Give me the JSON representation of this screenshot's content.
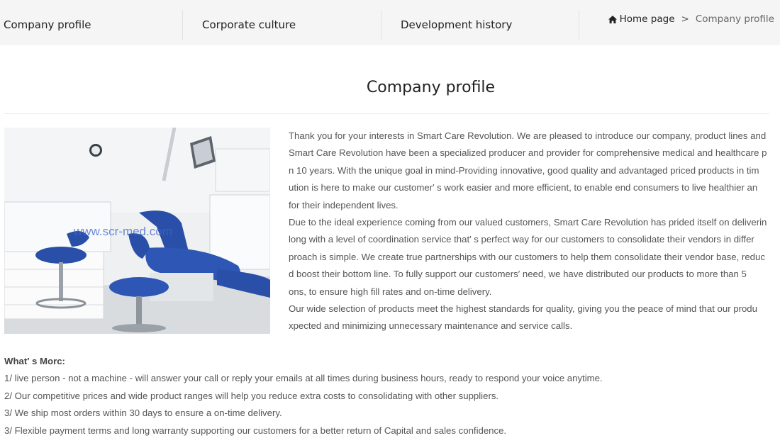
{
  "nav": {
    "tabs": [
      {
        "label": "Company profile"
      },
      {
        "label": "Corporate culture"
      },
      {
        "label": "Development history"
      }
    ],
    "breadcrumb": {
      "home_icon": "home-icon",
      "home": "Home page",
      "separator": ">",
      "current": "Company profile"
    }
  },
  "main": {
    "title": "Company profile",
    "photo": {
      "watermark": "www.scr-med.com",
      "accent_color": "#2a4fa8"
    },
    "intro_lines": [
      "Thank you for your interests in Smart Care Revolution. We are pleased to introduce our company, product lines and",
      "Smart Care Revolution have been a specialized producer and provider for comprehensive medical and healthcare p",
      "n 10 years. With the unique goal in mind-Providing innovative, good quality and advantaged priced products in tim",
      "ution is here to make our customer′ s work easier and more efficient, to enable end consumers to live healthier an",
      "for their independent lives.",
      "Due to the ideal experience coming from our valued customers, Smart Care Revolution has prided itself on deliverin",
      "long with a level of coordination service that′ s perfect way for our customers to consolidate their vendors in differ",
      "proach is simple. We create true partnerships with our customers to help them consolidate their vendor base, reduc",
      "d boost their bottom line. To fully support our customers′   need, we have distributed our products to more than 5",
      "ons, to ensure high fill rates and on-time delivery.",
      "Our wide selection of products meet the highest standards for quality, giving you the peace of mind that our produ",
      "xpected and minimizing unnecessary maintenance and service calls."
    ],
    "more": {
      "title": "What′ s Morc:",
      "items": [
        "1/ live person - not a machine - will answer your call or reply your emails at all times during business hours, ready to respond your voice anytime.",
        "2/ Our competitive prices and wide product ranges will help you reduce extra costs to consolidating with other suppliers.",
        "3/ We ship most orders within 30 days to ensure a on-time delivery.",
        "3/ Flexible payment terms and long warranty supporting our customers for a better return of Capital and sales confidence."
      ]
    }
  }
}
